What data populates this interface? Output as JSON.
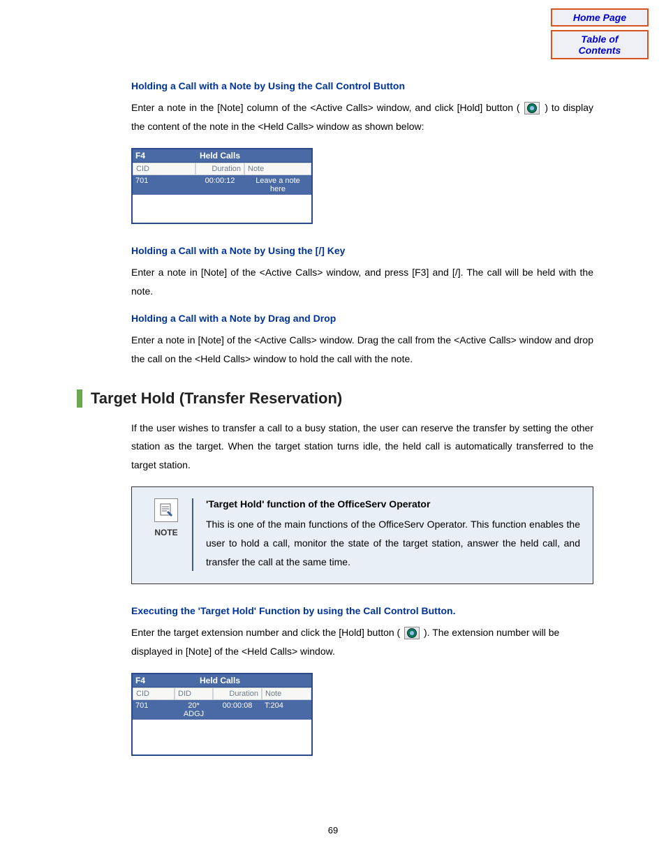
{
  "nav": {
    "home": "Home Page",
    "toc": "Table of Contents"
  },
  "sec1": {
    "heading": "Holding a Call with a Note by Using the Call Control Button",
    "para_before": "Enter a note in the [Note] column of the <Active Calls> window, and click [Hold] button (",
    "para_after": ") to display the content of the note in the <Held Calls> window as shown below:"
  },
  "held1": {
    "fkey": "F4",
    "title": "Held Calls",
    "col_cid": "CID",
    "col_dur": "Duration",
    "col_note": "Note",
    "row": {
      "cid": "701",
      "dur": "00:00:12",
      "note": "Leave a note here"
    }
  },
  "sec2": {
    "heading": "Holding a Call with a Note by Using the [/] Key",
    "para": "Enter a note in [Note] of the <Active Calls> window, and press [F3] and [/]. The call will be held with the note."
  },
  "sec3": {
    "heading": "Holding a Call with a Note by Drag and Drop",
    "para": "Enter a note in [Note] of the <Active Calls> window. Drag the call from the <Active Calls> window and drop the call on the <Held Calls> window to hold the call with the note."
  },
  "mainHeading": "Target Hold (Transfer Reservation)",
  "mainPara": "If the user wishes to transfer a call to a busy station, the user can reserve the transfer by setting the other station as the target. When the target station turns idle, the held call is automatically transferred to the target station.",
  "note": {
    "label": "NOTE",
    "title": "'Target Hold' function of the OfficeServ Operator",
    "body": "This is one of the main functions of the OfficeServ Operator. This function enables the user to hold a call, monitor the state of the target station, answer the held call, and transfer the call at the same time."
  },
  "sec4": {
    "heading": "Executing the 'Target Hold' Function by using the Call Control Button.",
    "para_before": "Enter the target extension number and click the [Hold] button (",
    "para_after": "). The extension number will be displayed in [Note] of the <Held Calls> window."
  },
  "held2": {
    "fkey": "F4",
    "title": "Held Calls",
    "col_cid": "CID",
    "col_did": "DID",
    "col_dur": "Duration",
    "col_note": "Note",
    "row": {
      "cid": "701",
      "did": "20* ADGJ",
      "dur": "00:00:08",
      "note": "T:204"
    }
  },
  "pageNum": "69"
}
